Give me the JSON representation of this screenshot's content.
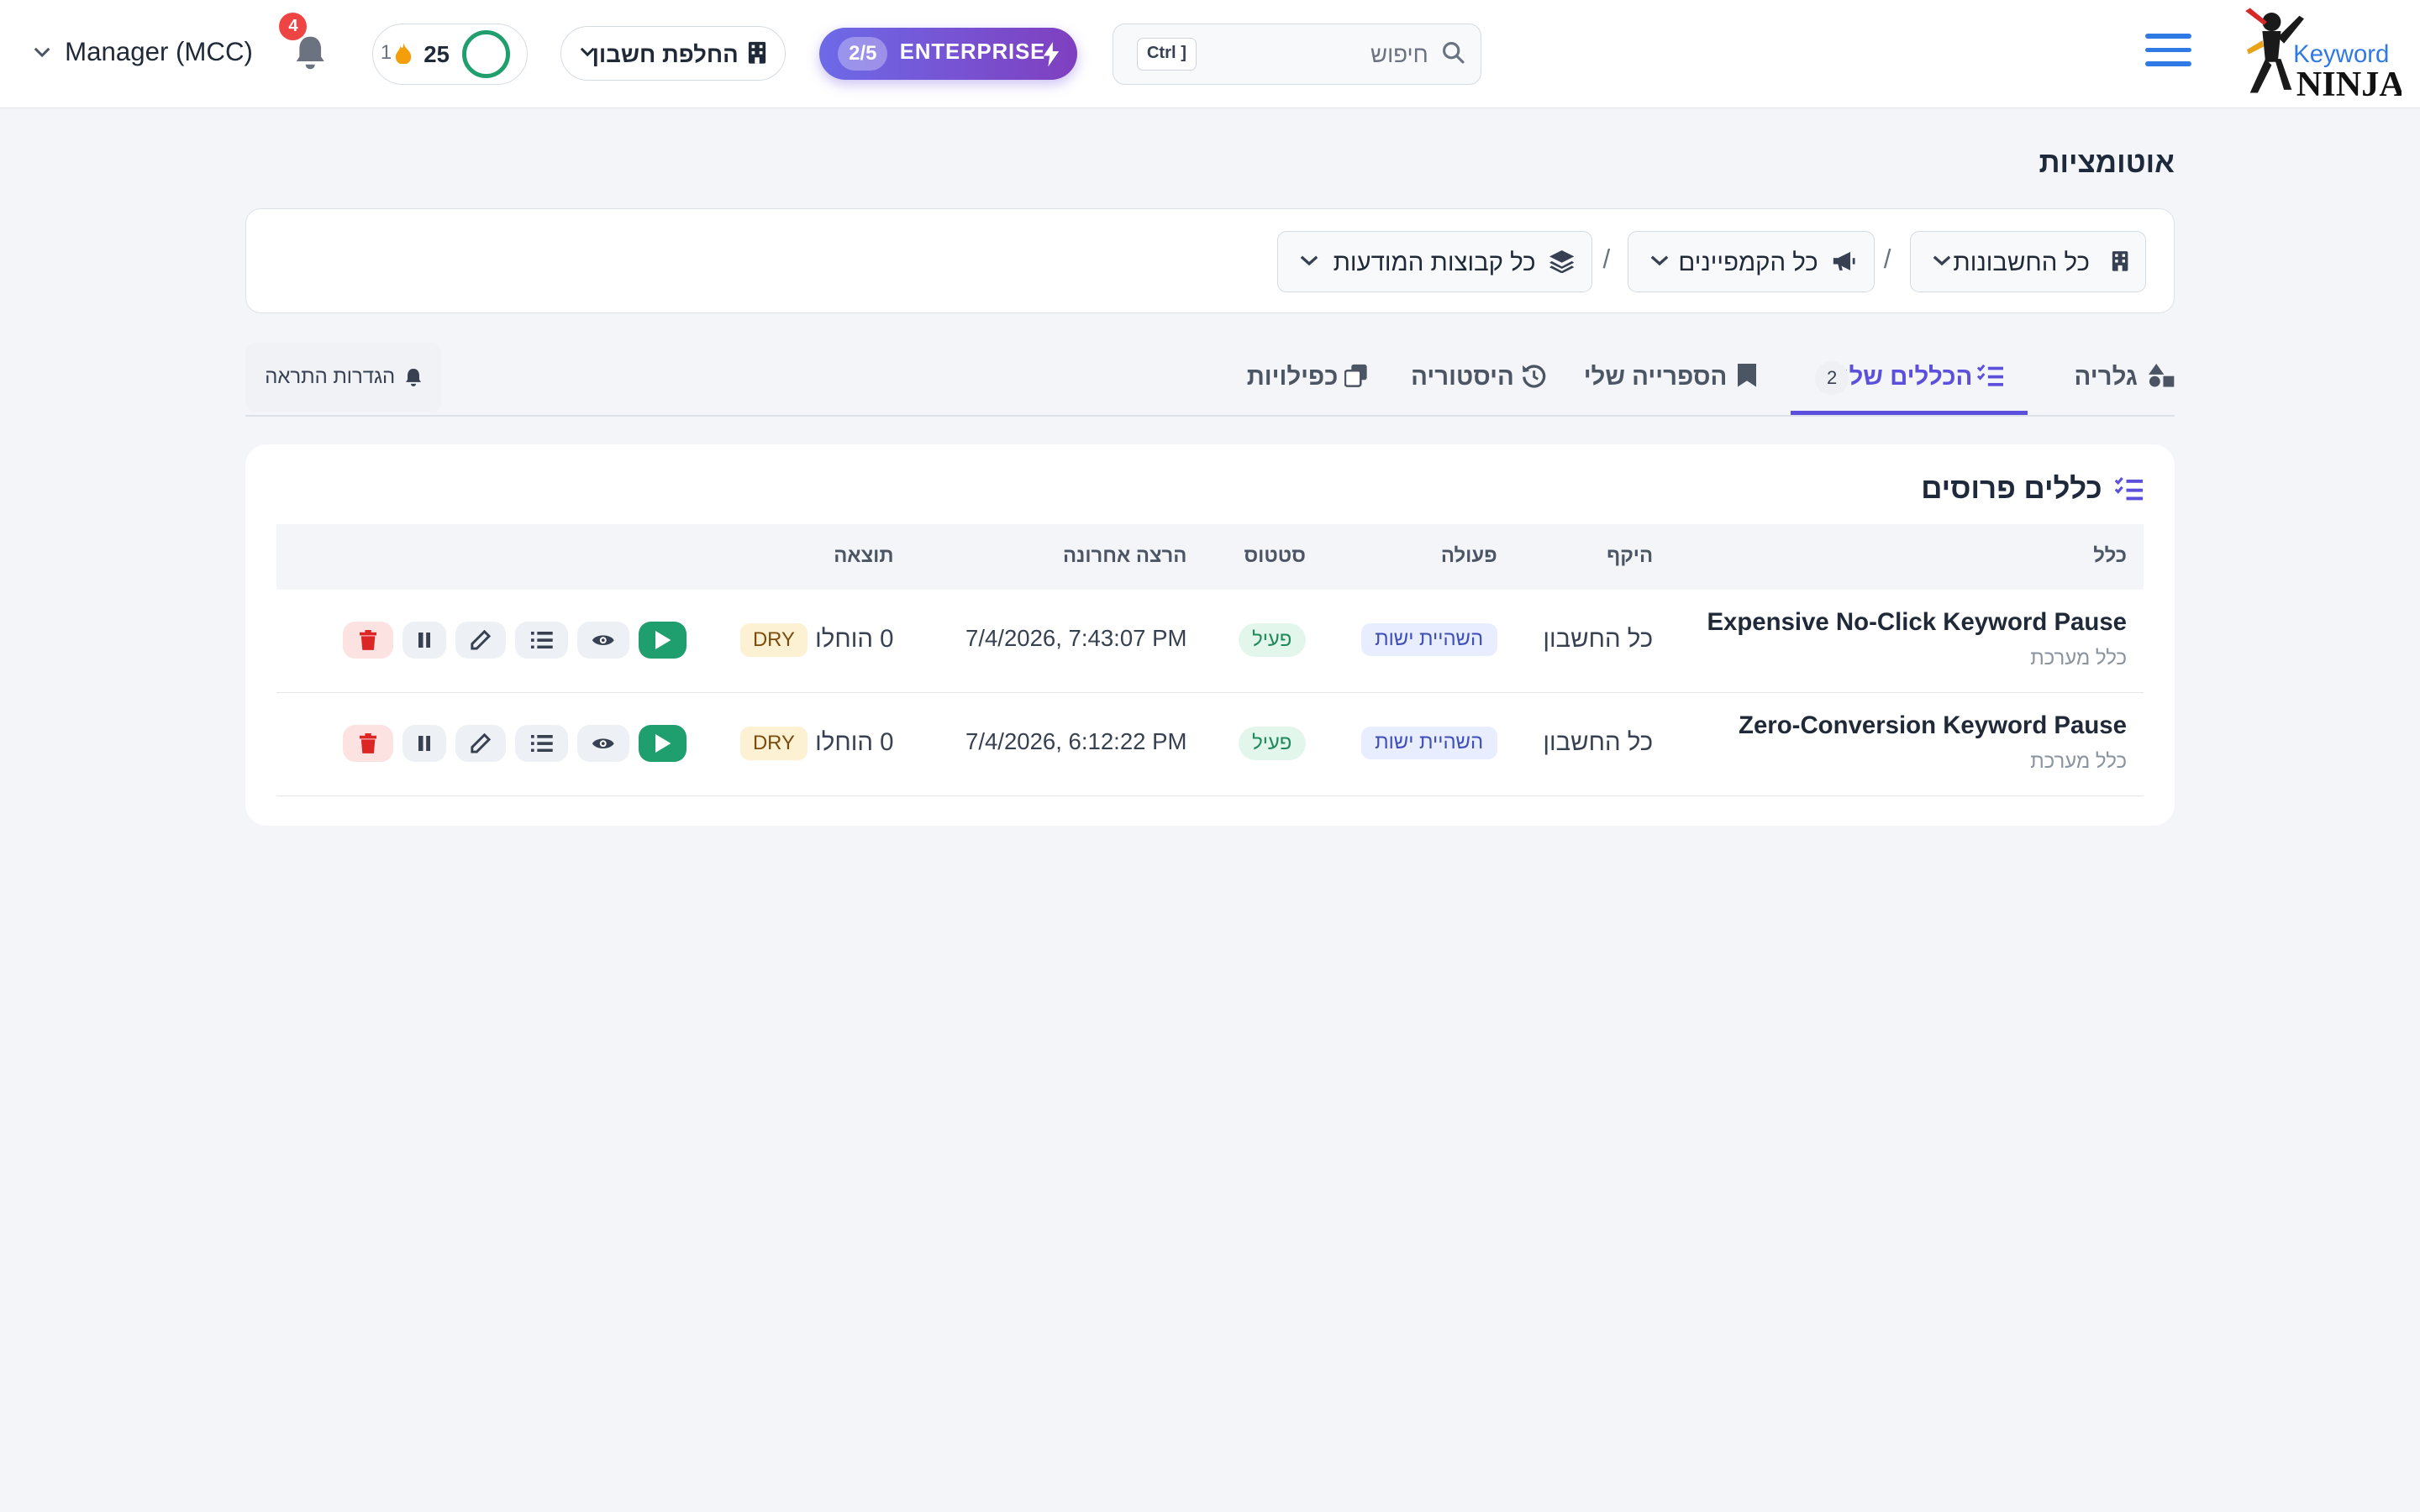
{
  "header": {
    "logo_top": "Keyword",
    "logo_bottom": "NINJA",
    "search_placeholder": "חיפוש",
    "search_shortcut": "Ctrl ]",
    "plan_label": "ENTERPRISE",
    "plan_count": "2/5",
    "switch_account": "החלפת חשבון",
    "streak_secondary": "1",
    "streak_points": "25",
    "notifications_count": "4",
    "account_name": "Manager (MCC)"
  },
  "page": {
    "title": "אוטומציות"
  },
  "filters": {
    "accounts": "כל החשבונות",
    "campaigns": "כל הקמפיינים",
    "ad_groups": "כל קבוצות המודעות",
    "separator": "/"
  },
  "tabs": [
    {
      "label": "גלריה",
      "icon": "shapes-icon"
    },
    {
      "label": "הכללים שלי",
      "icon": "list-check-icon",
      "count": "2",
      "active": true
    },
    {
      "label": "הספרייה שלי",
      "icon": "bookmark-icon"
    },
    {
      "label": "היסטוריה",
      "icon": "history-icon"
    },
    {
      "label": "כפילויות",
      "icon": "copy-icon"
    }
  ],
  "alert_settings": "הגדרות התראה",
  "rules_card": {
    "title": "כללים פרוסים",
    "columns": {
      "rule": "כלל",
      "scope": "היקף",
      "action": "פעולה",
      "status": "סטטוס",
      "last_run": "הרצה אחרונה",
      "result": "תוצאה"
    },
    "rows": [
      {
        "name": "Expensive No-Click Keyword Pause",
        "type": "כלל מערכת",
        "scope": "כל החשבון",
        "action": "השהיית ישות",
        "status": "פעיל",
        "last_run": "7/4/2026, 7:43:07 PM",
        "result": "0 הוחלו",
        "mode": "DRY"
      },
      {
        "name": "Zero-Conversion Keyword Pause",
        "type": "כלל מערכת",
        "scope": "כל החשבון",
        "action": "השהיית ישות",
        "status": "פעיל",
        "last_run": "7/4/2026, 6:12:22 PM",
        "result": "0 הוחלו",
        "mode": "DRY"
      }
    ]
  },
  "colors": {
    "primary": "#5b4fdb",
    "success": "#1f9e6e",
    "danger": "#dc2626",
    "hamburger": "#2f7ae5"
  }
}
